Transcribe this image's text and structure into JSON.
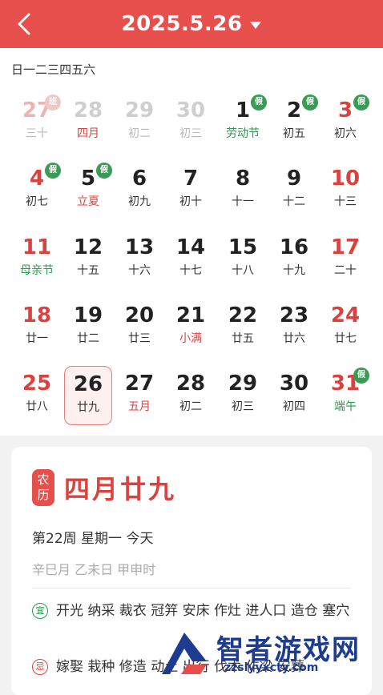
{
  "header": {
    "title": "2025.5.26"
  },
  "weekdays": [
    "日",
    "一",
    "二",
    "三",
    "四",
    "五",
    "六"
  ],
  "days": [
    {
      "n": "27",
      "s": "三十",
      "other": true,
      "weekend": true,
      "badge": "班",
      "badgeType": "work"
    },
    {
      "n": "28",
      "s": "四月",
      "other": true,
      "subType": "month"
    },
    {
      "n": "29",
      "s": "初二",
      "other": true
    },
    {
      "n": "30",
      "s": "初三",
      "other": true
    },
    {
      "n": "1",
      "s": "劳动节",
      "subType": "festival",
      "badge": "假",
      "badgeType": "holiday"
    },
    {
      "n": "2",
      "s": "初五",
      "badge": "假",
      "badgeType": "holiday"
    },
    {
      "n": "3",
      "s": "初六",
      "weekend": true,
      "badge": "假",
      "badgeType": "holiday"
    },
    {
      "n": "4",
      "s": "初七",
      "weekend": true,
      "badge": "假",
      "badgeType": "holiday"
    },
    {
      "n": "5",
      "s": "立夏",
      "subType": "term",
      "badge": "假",
      "badgeType": "holiday"
    },
    {
      "n": "6",
      "s": "初九"
    },
    {
      "n": "7",
      "s": "初十"
    },
    {
      "n": "8",
      "s": "十一"
    },
    {
      "n": "9",
      "s": "十二"
    },
    {
      "n": "10",
      "s": "十三",
      "weekend": true
    },
    {
      "n": "11",
      "s": "母亲节",
      "weekend": true,
      "subType": "festival"
    },
    {
      "n": "12",
      "s": "十五"
    },
    {
      "n": "13",
      "s": "十六"
    },
    {
      "n": "14",
      "s": "十七"
    },
    {
      "n": "15",
      "s": "十八"
    },
    {
      "n": "16",
      "s": "十九"
    },
    {
      "n": "17",
      "s": "二十",
      "weekend": true
    },
    {
      "n": "18",
      "s": "廿一",
      "weekend": true
    },
    {
      "n": "19",
      "s": "廿二"
    },
    {
      "n": "20",
      "s": "廿三"
    },
    {
      "n": "21",
      "s": "小满",
      "subType": "term"
    },
    {
      "n": "22",
      "s": "廿五"
    },
    {
      "n": "23",
      "s": "廿六"
    },
    {
      "n": "24",
      "s": "廿七",
      "weekend": true
    },
    {
      "n": "25",
      "s": "廿八",
      "weekend": true
    },
    {
      "n": "26",
      "s": "廿九",
      "selected": true
    },
    {
      "n": "27",
      "s": "五月",
      "subType": "month"
    },
    {
      "n": "28",
      "s": "初二"
    },
    {
      "n": "29",
      "s": "初三"
    },
    {
      "n": "30",
      "s": "初四"
    },
    {
      "n": "31",
      "s": "端午",
      "weekend": true,
      "subType": "festival",
      "badge": "假",
      "badgeType": "holiday"
    }
  ],
  "detail": {
    "seal": "农历",
    "lunar_date": "四月廿九",
    "week_line": "第22周 星期一 今天",
    "ganzhi": "辛巳月 乙未日 甲申时",
    "yi_icon": "宜",
    "yi_text": "开光 纳采 裁衣 冠笄 安床 作灶 进人口 造仓 塞穴",
    "ji_icon": "忌",
    "ji_text": "嫁娶 栽种 修造 动土 出行 伐木 作梁 安葬"
  },
  "watermark": {
    "name": "智者游戏网",
    "url": "zzslyyxcty.com"
  },
  "colors": {
    "accent": "#e64f4c",
    "holiday": "#3b9a56",
    "festival": "#2a9a4c"
  }
}
